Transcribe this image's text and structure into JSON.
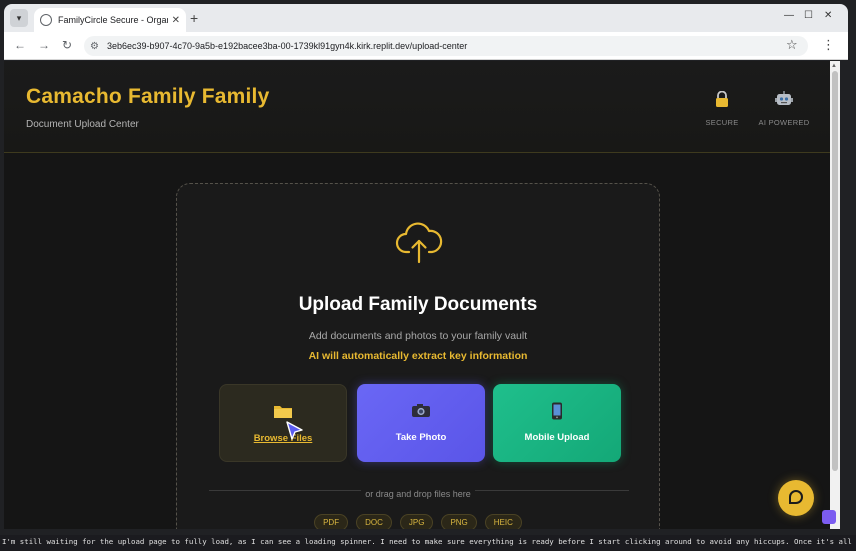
{
  "browser": {
    "tab_title": "FamilyCircle Secure - Organiz",
    "url": "3eb6ec39-b907-4c70-9a5b-e192bacee3ba-00-1739kl91gyn4k.kirk.replit.dev/upload-center"
  },
  "header": {
    "title": "Camacho Family Family",
    "subtitle": "Document Upload Center",
    "badges": [
      {
        "icon": "lock-icon",
        "label": "SECURE"
      },
      {
        "icon": "robot-icon",
        "label": "AI POWERED"
      }
    ]
  },
  "upload": {
    "title": "Upload Family Documents",
    "subtitle": "Add documents and photos to your family vault",
    "ai_note": "AI will automatically extract key information",
    "buttons": {
      "browse": "Browse Files",
      "photo": "Take Photo",
      "mobile": "Mobile Upload"
    },
    "divider": "or drag and drop files here",
    "file_types": [
      "PDF",
      "DOC",
      "JPG",
      "PNG",
      "HEIC"
    ]
  },
  "caption": "I'm still waiting for the upload page to fully load, as I can see a loading spinner. I need to make sure everything is ready before I start clicking around to avoid any hiccups. Once it's all loaded up, I'll be",
  "colors": {
    "accent_gold": "#e8b931",
    "photo_button": "#5a55e8",
    "mobile_button": "#14a877"
  }
}
